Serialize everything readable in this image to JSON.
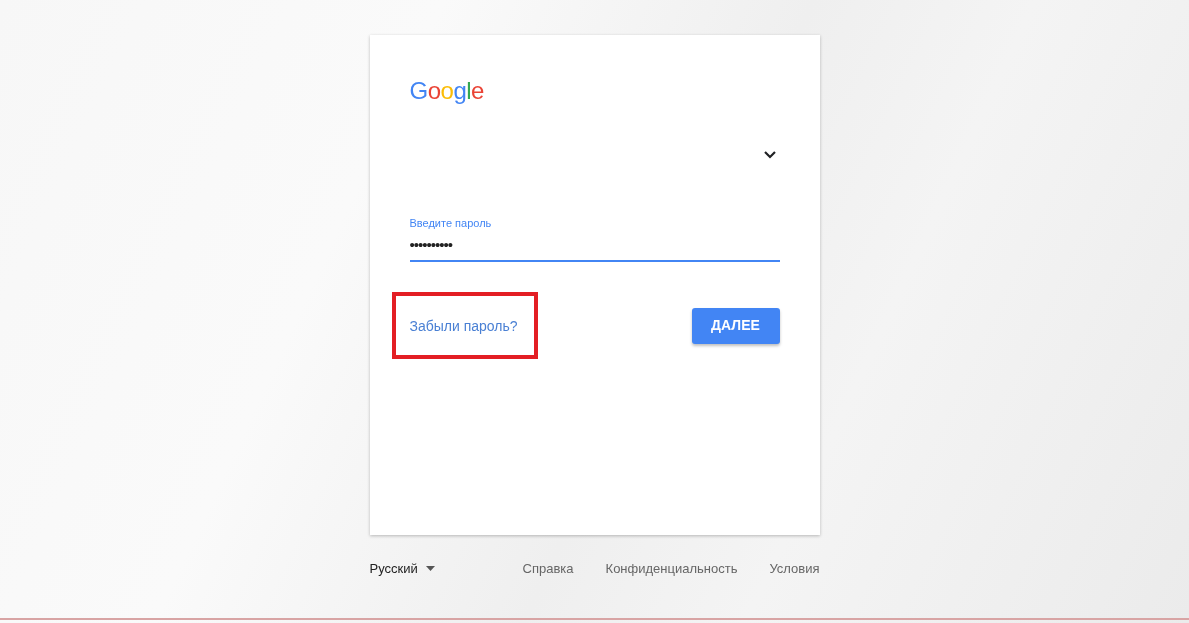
{
  "logo": "Google",
  "account_menu": {
    "expanded": false
  },
  "password_field": {
    "label": "Введите пароль",
    "value": "••••••••••",
    "focused": true
  },
  "forgot_link": {
    "text": "Забыли пароль?",
    "highlighted": true
  },
  "next_button": {
    "label": "ДАЛЕЕ"
  },
  "footer": {
    "language": "Русский",
    "links": [
      "Справка",
      "Конфиденциальность",
      "Условия"
    ]
  }
}
